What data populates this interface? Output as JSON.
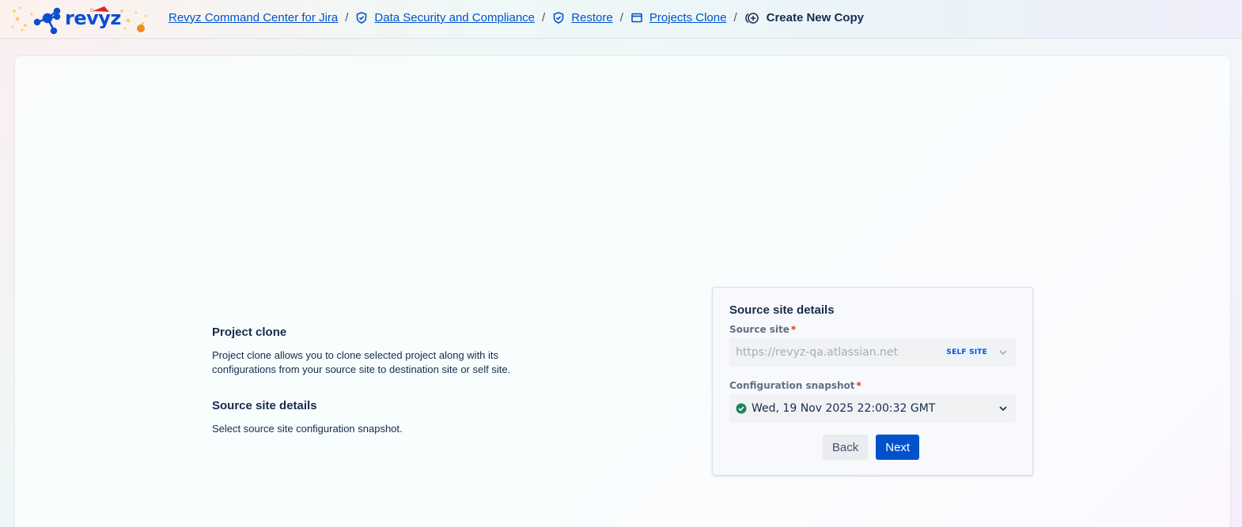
{
  "header": {
    "logo_text": "revyz",
    "breadcrumbs": [
      {
        "label": "Revyz Command Center for Jira"
      },
      {
        "label": "Data Security and Compliance"
      },
      {
        "label": "Restore"
      },
      {
        "label": "Projects Clone"
      }
    ],
    "current": "Create New Copy",
    "separator": "/"
  },
  "info": {
    "title": "Project clone",
    "description": "Project clone allows you to clone selected project along with its configurations from your source site to destination site or self site.",
    "subtitle": "Source site details",
    "subdescription": "Select source site configuration snapshot."
  },
  "form": {
    "title": "Source site details",
    "source_site": {
      "label": "Source site",
      "required": "*",
      "value": "https://revyz-qa.atlassian.net",
      "badge": "SELF SITE"
    },
    "snapshot": {
      "label": "Configuration snapshot",
      "required": "*",
      "value": "Wed, 19 Nov 2025 22:00:32 GMT"
    },
    "back_label": "Back",
    "next_label": "Next"
  },
  "colors": {
    "link": "#0052cc",
    "primary": "#0052cc",
    "success": "#1f845a",
    "required": "#de350b"
  },
  "icons": {
    "logo": "revyz-molecule-logo",
    "security": "shield-check-icon",
    "restore": "shield-check-icon",
    "projects": "window-icon",
    "create": "add-circle-icon",
    "select": "chevron-down-icon",
    "status": "check-circle-icon"
  }
}
